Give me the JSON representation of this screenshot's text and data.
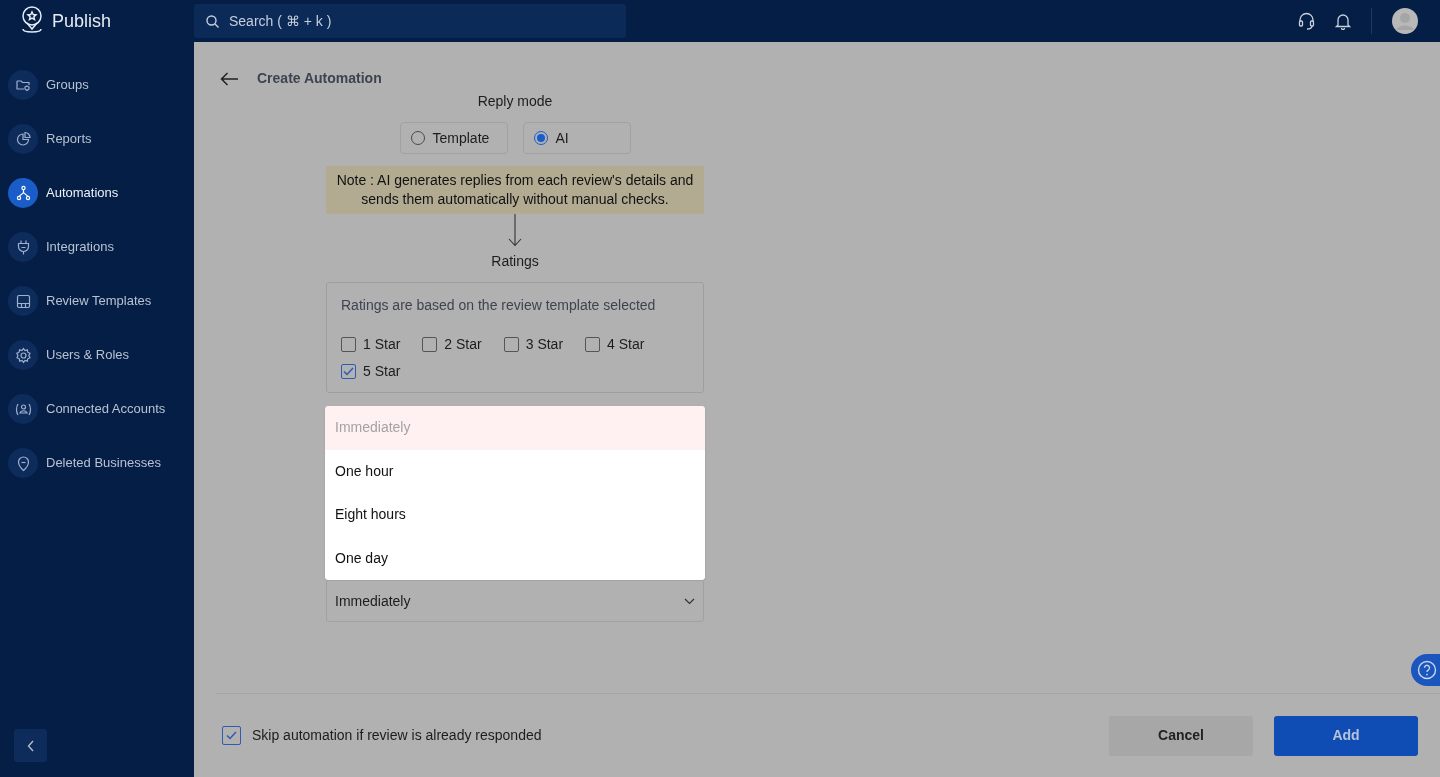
{
  "app": {
    "name": "Publish"
  },
  "search": {
    "placeholder": "Search ( ⌘ + k )"
  },
  "sidebar": {
    "items": [
      {
        "label": "Groups",
        "selected": false
      },
      {
        "label": "Reports",
        "selected": false
      },
      {
        "label": "Automations",
        "selected": true
      },
      {
        "label": "Integrations",
        "selected": false
      },
      {
        "label": "Review Templates",
        "selected": false
      },
      {
        "label": "Users & Roles",
        "selected": false
      },
      {
        "label": "Connected Accounts",
        "selected": false
      },
      {
        "label": "Deleted Businesses",
        "selected": false
      }
    ]
  },
  "page": {
    "title": "Create Automation"
  },
  "reply_mode": {
    "label": "Reply mode",
    "options": [
      {
        "label": "Template",
        "selected": false
      },
      {
        "label": "AI",
        "selected": true
      }
    ]
  },
  "note": "Note : AI generates replies from each review's details and sends them automatically without manual checks.",
  "ratings": {
    "label": "Ratings",
    "hint": "Ratings are based on the review template selected",
    "options": [
      {
        "label": "1 Star",
        "checked": false
      },
      {
        "label": "2 Star",
        "checked": false
      },
      {
        "label": "3 Star",
        "checked": false
      },
      {
        "label": "4 Star",
        "checked": false
      },
      {
        "label": "5 Star",
        "checked": true
      }
    ]
  },
  "delay_select": {
    "value": "Immediately",
    "options": [
      {
        "label": "Immediately",
        "selected": true
      },
      {
        "label": "One hour",
        "selected": false
      },
      {
        "label": "Eight hours",
        "selected": false
      },
      {
        "label": "One day",
        "selected": false
      }
    ]
  },
  "skip_option": {
    "label": "Skip automation if review is already responded",
    "checked": true
  },
  "buttons": [
    {
      "label": "Cancel",
      "kind": "secondary"
    },
    {
      "label": "Add",
      "kind": "primary"
    }
  ]
}
